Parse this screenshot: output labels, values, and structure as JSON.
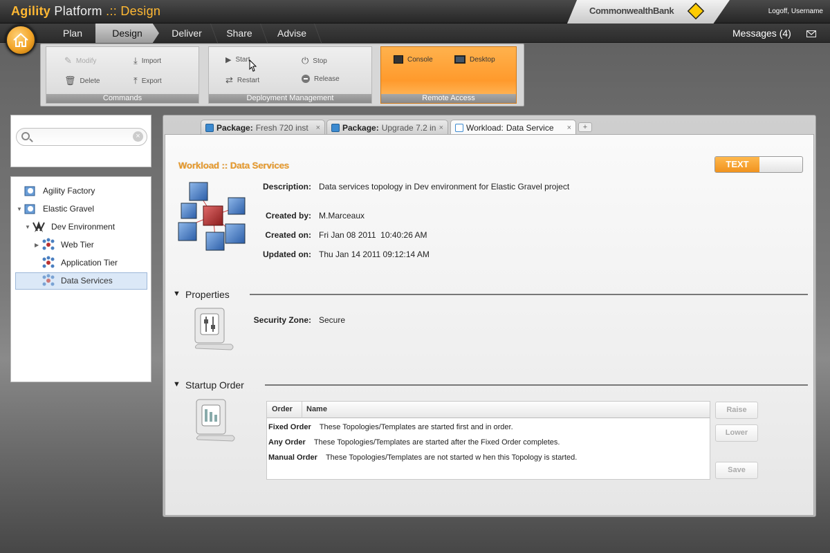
{
  "app": {
    "title_brand": "Agility",
    "title_rest": "Platform",
    "title_mode": ".:: Design"
  },
  "brand": {
    "name": "CommonwealthBank"
  },
  "user": {
    "links": "Logoff, Username"
  },
  "nav": {
    "items": [
      {
        "label": "Plan",
        "active": false
      },
      {
        "label": "Design",
        "active": true
      },
      {
        "label": "Deliver",
        "active": false
      },
      {
        "label": "Share",
        "active": false
      },
      {
        "label": "Advise",
        "active": false
      }
    ],
    "messages": "Messages (4)"
  },
  "ribbon": {
    "commands": {
      "label": "Commands",
      "modify": "Modify",
      "import": "Import",
      "delete": "Delete",
      "export": "Export"
    },
    "deployment": {
      "label": "Deployment Management",
      "start": "Start",
      "stop": "Stop",
      "restart": "Restart",
      "release": "Release"
    },
    "remote": {
      "label": "Remote Access",
      "console": "Console",
      "desktop": "Desktop"
    }
  },
  "search": {
    "placeholder": "",
    "value": ""
  },
  "tree": {
    "items": [
      {
        "label": "Agility Factory",
        "level": 0,
        "expander": ""
      },
      {
        "label": "Elastic Gravel",
        "level": 0,
        "expander": "▼"
      },
      {
        "label": "Dev Environment",
        "level": 1,
        "expander": "▼"
      },
      {
        "label": "Web Tier",
        "level": 2,
        "expander": "▶"
      },
      {
        "label": "Application Tier",
        "level": 2,
        "expander": ""
      },
      {
        "label": "Data Services",
        "level": 2,
        "expander": "",
        "selected": true
      }
    ]
  },
  "tabs": [
    {
      "kind": "Package:",
      "name": "Fresh 720 inst",
      "close": "×",
      "active": false
    },
    {
      "kind": "Package:",
      "name": "Upgrade 7.2 in",
      "close": "×",
      "active": false
    },
    {
      "kind": "Workload:",
      "name": "Data Service",
      "close": "×",
      "active": true
    }
  ],
  "add_tab": "+",
  "workload": {
    "title": "Workload :: Data Services",
    "toggle_label": "TEXT",
    "description_label": "Description:",
    "description": "Data services topology in Dev environment for Elastic Gravel project",
    "created_by_label": "Created by:",
    "created_by": "M.Marceaux",
    "created_on_label": "Created on:",
    "created_on": "Fri Jan 08 2011  10:40:26 AM",
    "updated_on_label": "Updated on:",
    "updated_on": "Thu Jan 14 2011 09:12:14 AM"
  },
  "properties": {
    "heading": "Properties",
    "security_zone_label": "Security Zone:",
    "security_zone": "Secure"
  },
  "startup": {
    "heading": "Startup Order",
    "columns": [
      "Order",
      "Name"
    ],
    "rows": [
      {
        "order": "Fixed Order",
        "text": "These Topologies/Templates are started first and in order."
      },
      {
        "order": "Any Order",
        "text": "These Topologies/Templates are started after the Fixed Order completes."
      },
      {
        "order": "Manual Order",
        "text": "These Topologies/Templates are not started w hen this Topology is started."
      }
    ],
    "buttons": {
      "raise": "Raise",
      "lower": "Lower",
      "save": "Save"
    }
  },
  "colors": {
    "accent": "#ff9a2c",
    "title_orange": "#e89a2c"
  }
}
